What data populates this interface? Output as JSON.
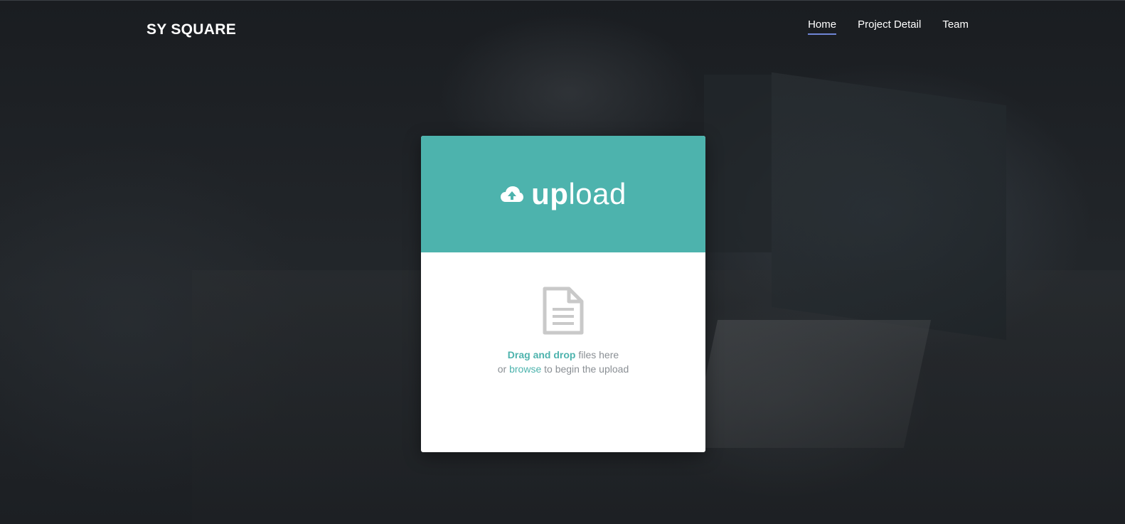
{
  "header": {
    "brand": "SY SQUARE",
    "nav": [
      "Home",
      "Project Detail",
      "Team"
    ],
    "active": "Home"
  },
  "upload": {
    "title_bold": "up",
    "title_light": "load",
    "line1_link": "Drag and drop",
    "line1_text": " files here",
    "line2_prefix": "or ",
    "line2_link": "browse",
    "line2_text": " to begin the upload"
  },
  "colors": {
    "accent": "#4db3ad",
    "nav_underline": "#6f86d6",
    "background": "#1b1e22"
  },
  "icons": [
    "cloud-upload-icon",
    "file-icon"
  ]
}
